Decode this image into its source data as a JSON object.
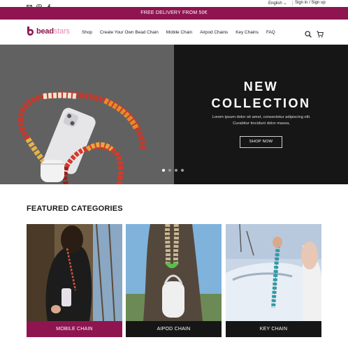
{
  "topbar": {
    "social_icons": [
      "mail-icon",
      "instagram-icon",
      "facebook-icon"
    ],
    "language": "English ⌄",
    "account": "Sign in / Sign up"
  },
  "promo": {
    "text": "FREE DELIVERY FROM 50€"
  },
  "header": {
    "logo_text_1": "bead",
    "logo_text_2": "stars",
    "nav": [
      "Shop",
      "Create Your Own Bead Chain",
      "Mobile Chain",
      "Airpod Chains",
      "Key Chains",
      "FAQ"
    ],
    "icons": [
      "search-icon",
      "cart-icon"
    ]
  },
  "hero": {
    "title_line1": "NEW",
    "title_line2": "COLLECTION",
    "subtitle": "Lorem ipsum dolor sit amet, consectetur adipiscing elit. Curabitur tincidunt dolor massa,",
    "button": "SHOP NOW",
    "slides": 4,
    "active_slide": 1
  },
  "featured": {
    "title": "FEATURED CATEGORIES",
    "cards": [
      {
        "label": "MOBILE CHAIN",
        "color": "#8e1550"
      },
      {
        "label": "AIPOD CHAIN",
        "color": "#161616"
      },
      {
        "label": "KEY CHAIN",
        "color": "#161616"
      }
    ]
  },
  "colors": {
    "brand": "#8e1550",
    "dark": "#161616",
    "logo_light": "#e08db0"
  }
}
